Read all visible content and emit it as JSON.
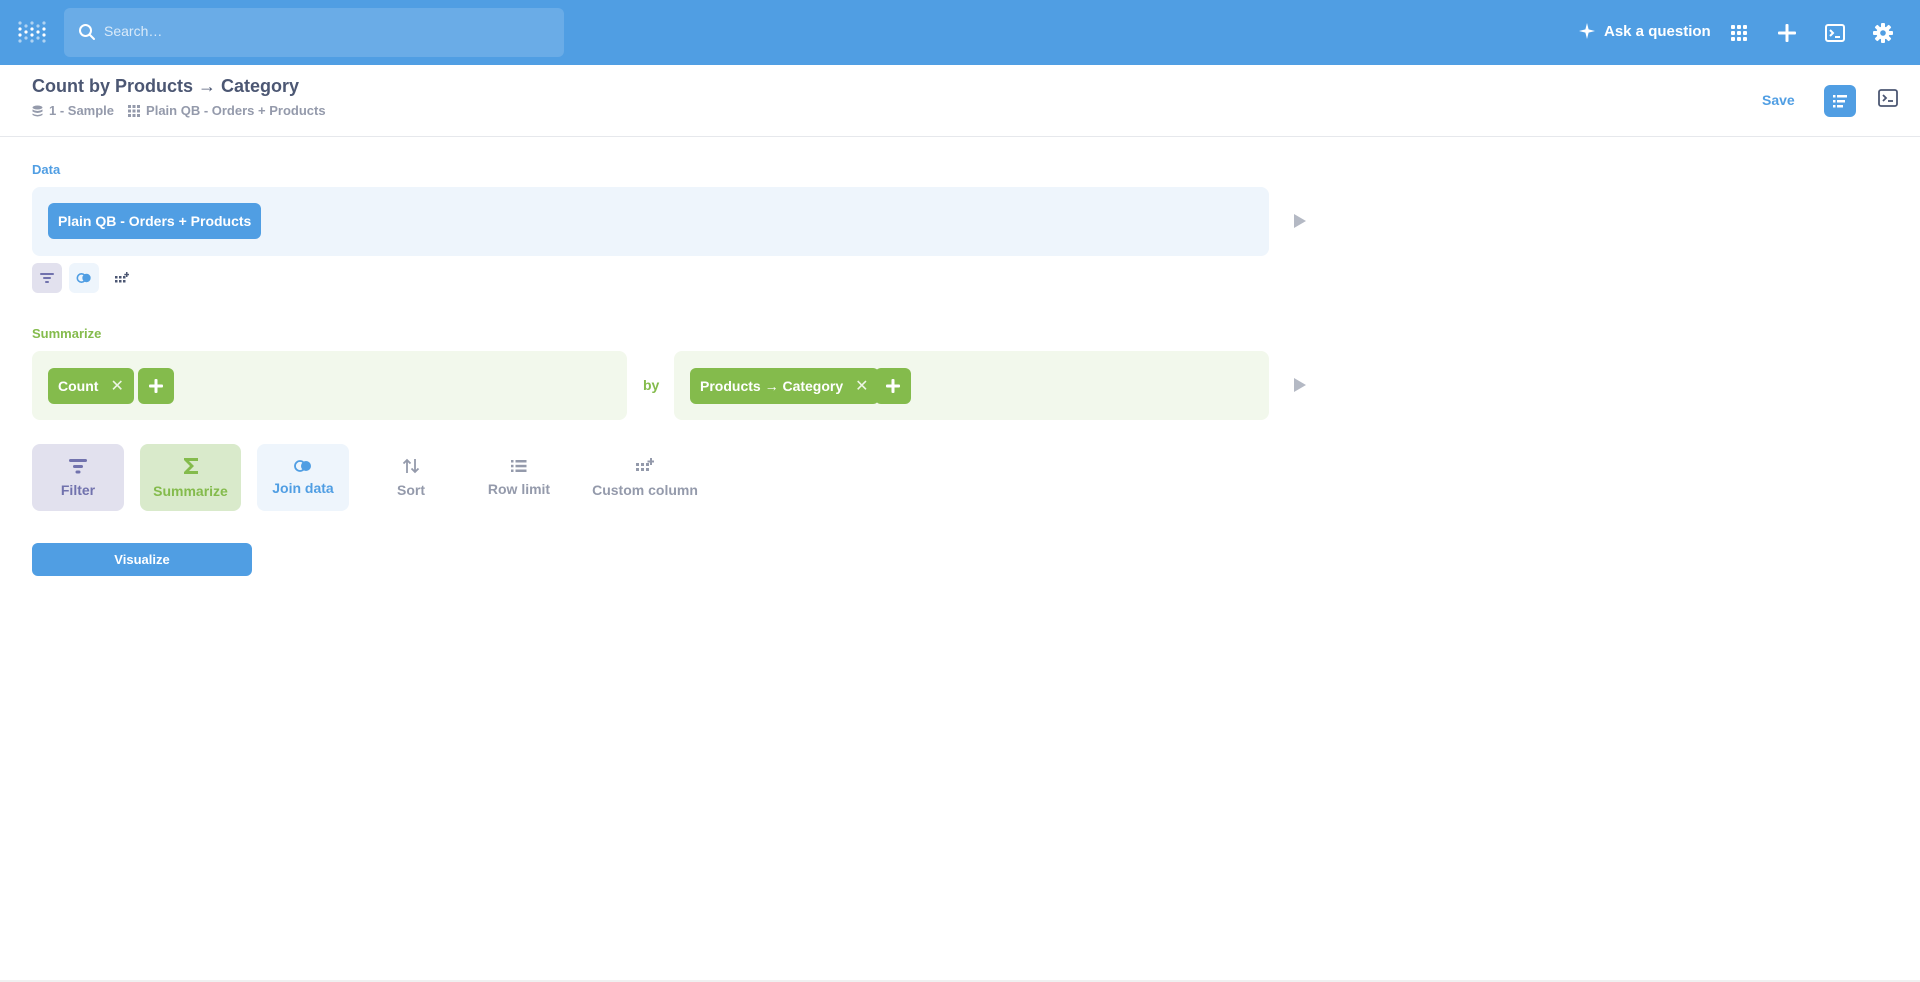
{
  "colors": {
    "brand": "#509ee3",
    "summarize": "#84bb4c",
    "filter": "#7172ad",
    "text": "#4c5773",
    "muted": "#949aab"
  },
  "navbar": {
    "search_placeholder": "Search…",
    "ask_label": "Ask a question",
    "icons": [
      "metabase-logo-icon",
      "search-icon",
      "sparkle-icon",
      "grid-icon",
      "plus-icon",
      "console-icon",
      "gear-icon"
    ]
  },
  "header": {
    "title": "Count by Products → Category",
    "crumbs": [
      {
        "icon": "database-icon",
        "label": "1 - Sample"
      },
      {
        "icon": "table-grid-icon",
        "label": "Plain QB - Orders + Products"
      }
    ],
    "save_label": "Save"
  },
  "data_section": {
    "label": "Data",
    "source_label": "Plain QB - Orders + Products"
  },
  "summarize_section": {
    "label": "Summarize",
    "metric_label": "Count",
    "by_label": "by",
    "breakout_label": "Products → Category"
  },
  "steps": [
    {
      "label": "Filter",
      "icon": "filter-icon"
    },
    {
      "label": "Summarize",
      "icon": "sigma-icon"
    },
    {
      "label": "Join data",
      "icon": "join-icon"
    },
    {
      "label": "Sort",
      "icon": "sort-icon"
    },
    {
      "label": "Row limit",
      "icon": "list-icon"
    },
    {
      "label": "Custom column",
      "icon": "add-column-icon"
    }
  ],
  "visualize_label": "Visualize"
}
